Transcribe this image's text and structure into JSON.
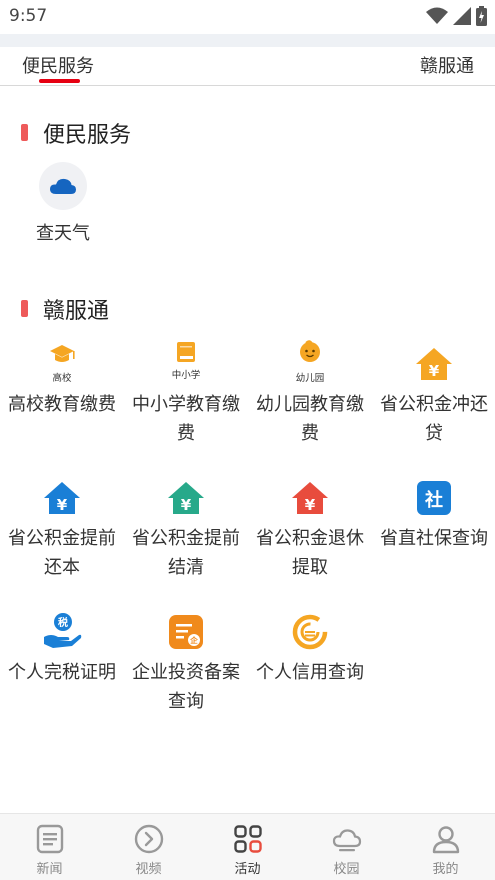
{
  "status": {
    "time": "9:57"
  },
  "tabs": {
    "left": "便民服务",
    "right": "赣服通"
  },
  "section1": {
    "title": "便民服务",
    "items": [
      {
        "label": "查天气",
        "icon": "cloud-icon"
      }
    ]
  },
  "section2": {
    "title": "赣服通",
    "items": [
      {
        "label": "高校教育缴费",
        "icon_text": "高校",
        "icon": "graduation-cap-icon"
      },
      {
        "label": "中小学教育缴费",
        "icon_text": "中小学",
        "icon": "book-icon"
      },
      {
        "label": "幼儿园教育缴费",
        "icon_text": "幼儿园",
        "icon": "child-face-icon"
      },
      {
        "label": "省公积金冲还贷",
        "icon": "house-yuan-icon"
      },
      {
        "label": "省公积金提前还本",
        "icon": "house-yuan-icon"
      },
      {
        "label": "省公积金提前结清",
        "icon": "house-yuan-icon"
      },
      {
        "label": "省公积金退休提取",
        "icon": "house-yuan-icon"
      },
      {
        "label": "省直社保查询",
        "icon": "social-security-icon"
      },
      {
        "label": "个人完税证明",
        "icon": "tax-hand-icon"
      },
      {
        "label": "企业投资备案查询",
        "icon": "enterprise-doc-icon"
      },
      {
        "label": "个人信用查询",
        "icon": "credit-icon"
      }
    ]
  },
  "bottom_nav": [
    {
      "label": "新闻",
      "icon": "news-icon"
    },
    {
      "label": "视频",
      "icon": "video-play-icon"
    },
    {
      "label": "活动",
      "icon": "grid-squares-icon",
      "active": true
    },
    {
      "label": "校园",
      "icon": "cloud-outline-icon"
    },
    {
      "label": "我的",
      "icon": "person-icon"
    }
  ],
  "colors": {
    "accent": "#e60012",
    "section_bar": "#ee5a5a",
    "blue": "#1a7fd6",
    "teal": "#27a98a",
    "red": "#e84c3d",
    "orange": "#f5a623"
  }
}
